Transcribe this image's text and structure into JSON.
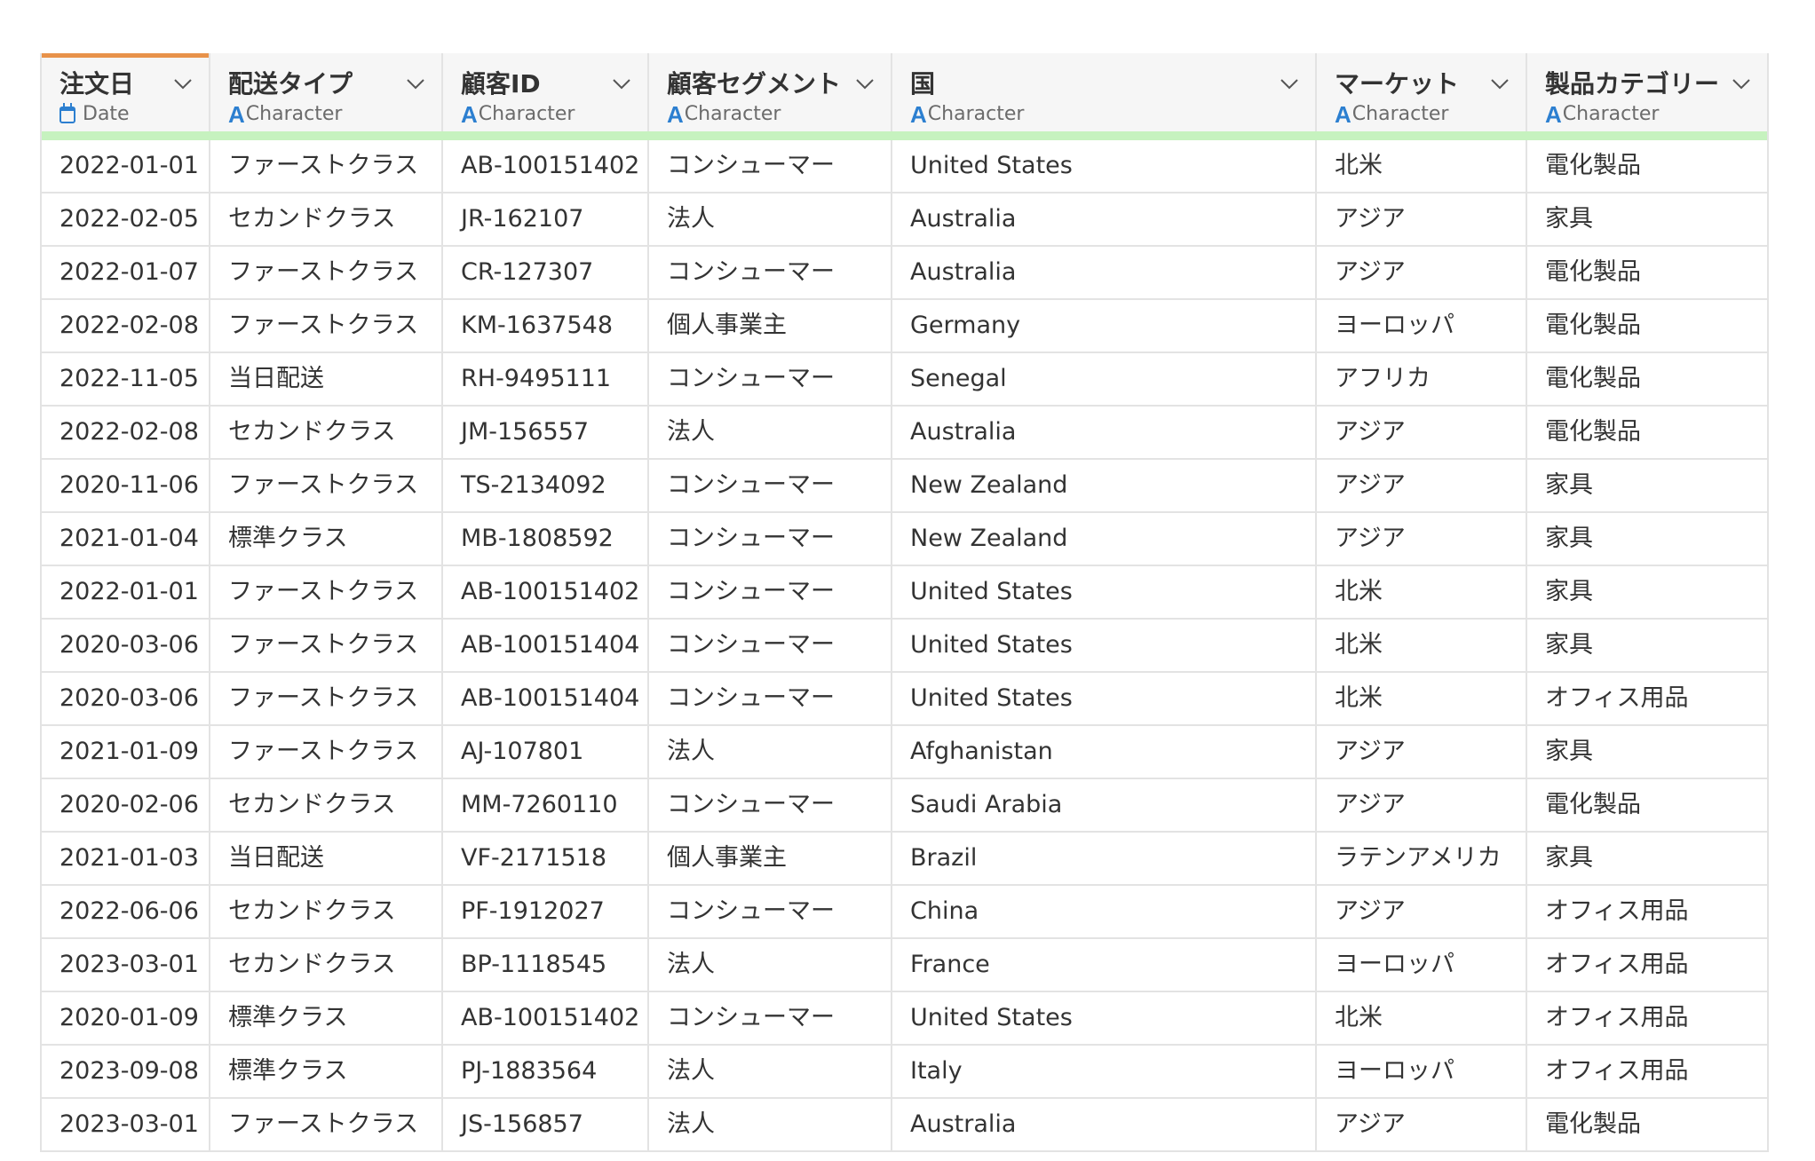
{
  "columns": [
    {
      "name": "注文日",
      "type": "Date",
      "type_icon": "calendar-icon"
    },
    {
      "name": "配送タイプ",
      "type": "Character",
      "type_icon": "A"
    },
    {
      "name": "顧客ID",
      "type": "Character",
      "type_icon": "A"
    },
    {
      "name": "顧客セグメント",
      "type": "Character",
      "type_icon": "A"
    },
    {
      "name": "国",
      "type": "Character",
      "type_icon": "A"
    },
    {
      "name": "マーケット",
      "type": "Character",
      "type_icon": "A"
    },
    {
      "name": "製品カテゴリー",
      "type": "Character",
      "type_icon": "A"
    }
  ],
  "colors": {
    "active_column_accent": "#e8924a",
    "type_icon": "#2c7fd0",
    "quality_bar": "#c6f2bf"
  },
  "rows": [
    [
      "2022-01-01",
      "ファーストクラス",
      "AB-100151402",
      "コンシューマー",
      "United States",
      "北米",
      "電化製品"
    ],
    [
      "2022-02-05",
      "セカンドクラス",
      "JR-162107",
      "法人",
      "Australia",
      "アジア",
      "家具"
    ],
    [
      "2022-01-07",
      "ファーストクラス",
      "CR-127307",
      "コンシューマー",
      "Australia",
      "アジア",
      "電化製品"
    ],
    [
      "2022-02-08",
      "ファーストクラス",
      "KM-1637548",
      "個人事業主",
      "Germany",
      "ヨーロッパ",
      "電化製品"
    ],
    [
      "2022-11-05",
      "当日配送",
      "RH-9495111",
      "コンシューマー",
      "Senegal",
      "アフリカ",
      "電化製品"
    ],
    [
      "2022-02-08",
      "セカンドクラス",
      "JM-156557",
      "法人",
      "Australia",
      "アジア",
      "電化製品"
    ],
    [
      "2020-11-06",
      "ファーストクラス",
      "TS-2134092",
      "コンシューマー",
      "New Zealand",
      "アジア",
      "家具"
    ],
    [
      "2021-01-04",
      "標準クラス",
      "MB-1808592",
      "コンシューマー",
      "New Zealand",
      "アジア",
      "家具"
    ],
    [
      "2022-01-01",
      "ファーストクラス",
      "AB-100151402",
      "コンシューマー",
      "United States",
      "北米",
      "家具"
    ],
    [
      "2020-03-06",
      "ファーストクラス",
      "AB-100151404",
      "コンシューマー",
      "United States",
      "北米",
      "家具"
    ],
    [
      "2020-03-06",
      "ファーストクラス",
      "AB-100151404",
      "コンシューマー",
      "United States",
      "北米",
      "オフィス用品"
    ],
    [
      "2021-01-09",
      "ファーストクラス",
      "AJ-107801",
      "法人",
      "Afghanistan",
      "アジア",
      "家具"
    ],
    [
      "2020-02-06",
      "セカンドクラス",
      "MM-7260110",
      "コンシューマー",
      "Saudi Arabia",
      "アジア",
      "電化製品"
    ],
    [
      "2021-01-03",
      "当日配送",
      "VF-2171518",
      "個人事業主",
      "Brazil",
      "ラテンアメリカ",
      "家具"
    ],
    [
      "2022-06-06",
      "セカンドクラス",
      "PF-1912027",
      "コンシューマー",
      "China",
      "アジア",
      "オフィス用品"
    ],
    [
      "2023-03-01",
      "セカンドクラス",
      "BP-1118545",
      "法人",
      "France",
      "ヨーロッパ",
      "オフィス用品"
    ],
    [
      "2020-01-09",
      "標準クラス",
      "AB-100151402",
      "コンシューマー",
      "United States",
      "北米",
      "オフィス用品"
    ],
    [
      "2023-09-08",
      "標準クラス",
      "PJ-1883564",
      "法人",
      "Italy",
      "ヨーロッパ",
      "オフィス用品"
    ],
    [
      "2023-03-01",
      "ファーストクラス",
      "JS-156857",
      "法人",
      "Australia",
      "アジア",
      "電化製品"
    ]
  ]
}
